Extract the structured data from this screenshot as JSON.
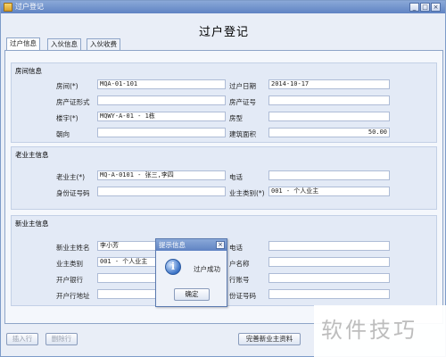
{
  "window": {
    "title": "过户登记",
    "controls": [
      "_",
      "□",
      "×"
    ],
    "form_title": "过户登记"
  },
  "tabs": [
    {
      "label": "过户信息",
      "active": true
    },
    {
      "label": "入伙信息",
      "active": false
    },
    {
      "label": "入伙收费",
      "active": false
    }
  ],
  "house": {
    "group_title": "房间信息",
    "room_label": "房间(*)",
    "room_value": "MQA-01-101",
    "transfer_date_label": "过户日期",
    "transfer_date_value": "2014-10-17",
    "property_form_label": "房产证形式",
    "property_form_value": "",
    "property_no_label": "房产证号",
    "property_no_value": "",
    "building_label": "楼宇(*)",
    "building_value": "MQWY-A-01 - 1栋",
    "house_type_label": "房型",
    "house_type_value": "",
    "orientation_label": "朝向",
    "orientation_value": "",
    "area_label": "建筑面积",
    "area_value": "50.00"
  },
  "old_owner": {
    "group_title": "老业主信息",
    "owner_label": "老业主(*)",
    "owner_value": "MQ-A-0101 - 张三,李四",
    "phone_label": "电话",
    "phone_value": "",
    "id_label": "身份证号码",
    "id_value": "",
    "category_label": "业主类别(*)",
    "category_value": "001 - 个人业主"
  },
  "new_owner": {
    "group_title": "新业主信息",
    "name_label": "新业主姓名",
    "name_value": "李小芳",
    "phone_label": "电话",
    "phone_value": "",
    "category_label": "业主类别",
    "category_value": "001 - 个人业主",
    "account_name_label": "户名称",
    "account_name_value": "",
    "bank_label": "开户银行",
    "bank_value": "",
    "account_no_label": "行账号",
    "account_no_value": "",
    "bank_address_label": "开户行地址",
    "bank_address_value": "",
    "id_label": "份证号码",
    "id_value": ""
  },
  "buttons": {
    "insert_row": "插入行",
    "delete_row": "删除行",
    "complete_owner": "完善新业主资料"
  },
  "dialog": {
    "title": "提示信息",
    "close": "×",
    "icon": "i",
    "message": "过户成功",
    "ok": "确定"
  },
  "watermark": "软件技巧"
}
